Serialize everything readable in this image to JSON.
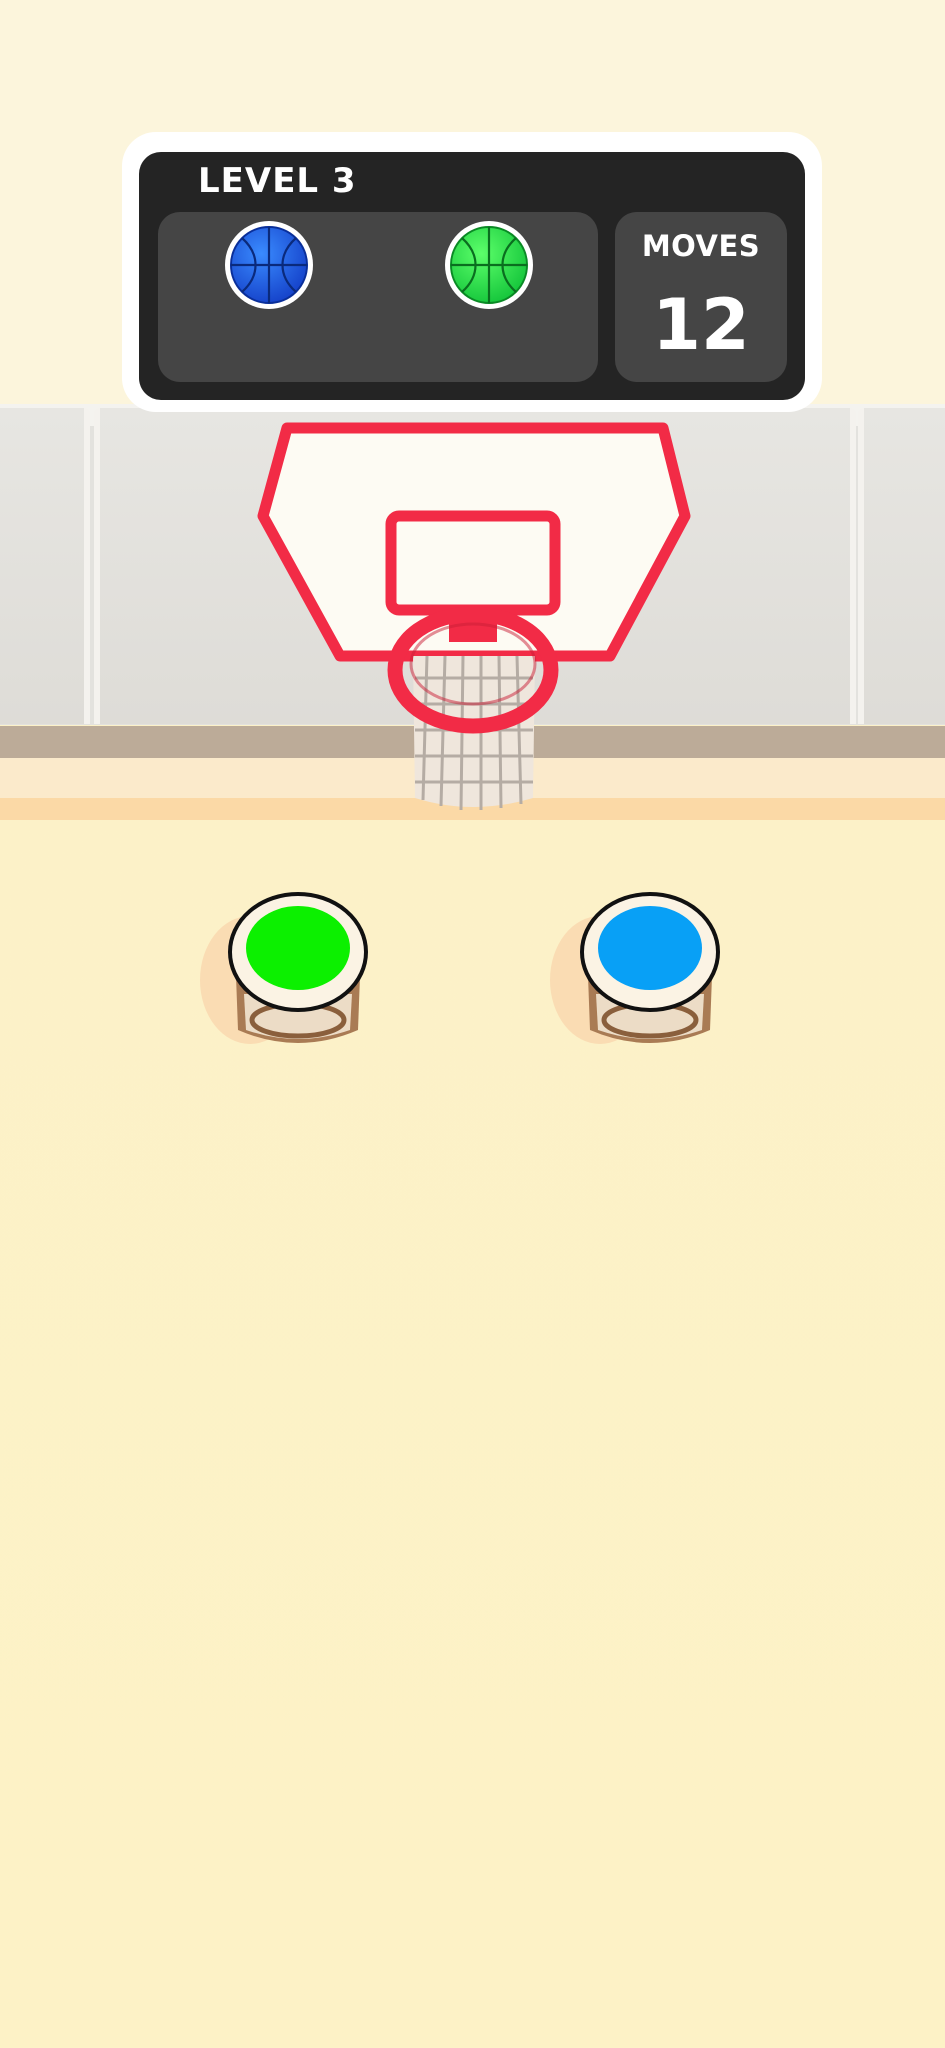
{
  "scoreboard": {
    "level_label": "LEVEL 3",
    "moves_label": "MOVES",
    "moves_value": "12",
    "target_balls": [
      {
        "color": "#1e5bf0",
        "icon": "basketball-icon"
      },
      {
        "color": "#1fe34a",
        "icon": "basketball-icon"
      }
    ]
  },
  "hoop": {
    "backboard_color": "#fdfbf3",
    "rim_color": "#f22b46",
    "net_color": "#efe6dc"
  },
  "buckets": [
    {
      "color": "#0cf000",
      "icon": "bucket-icon"
    },
    {
      "color": "#08a0f6",
      "icon": "bucket-icon"
    }
  ]
}
